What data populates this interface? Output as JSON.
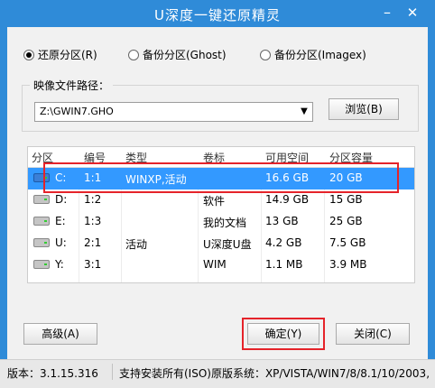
{
  "window": {
    "title": "U深度一键还原精灵",
    "minimize_glyph": "–",
    "close_glyph": "✕"
  },
  "mode": {
    "options": [
      {
        "label": "还原分区(R)",
        "selected": true
      },
      {
        "label": "备份分区(Ghost)",
        "selected": false
      },
      {
        "label": "备份分区(Imagex)",
        "selected": false
      }
    ]
  },
  "image_path": {
    "label": "映像文件路径：",
    "value": "Z:\\GWIN7.GHO",
    "browse_label": "浏览(B)"
  },
  "table": {
    "columns": [
      "分区",
      "编号",
      "类型",
      "卷标",
      "可用空间",
      "分区容量"
    ],
    "rows": [
      {
        "partition": "C:",
        "number": "1:1",
        "type": "WINXP,活动",
        "label": "",
        "free": "16.6 GB",
        "capacity": "20 GB",
        "selected": true,
        "icon": "system-drive-icon"
      },
      {
        "partition": "D:",
        "number": "1:2",
        "type": "",
        "label": "软件",
        "free": "14.9 GB",
        "capacity": "15 GB",
        "selected": false,
        "icon": "drive-icon"
      },
      {
        "partition": "E:",
        "number": "1:3",
        "type": "",
        "label": "我的文档",
        "free": "13 GB",
        "capacity": "25 GB",
        "selected": false,
        "icon": "drive-icon"
      },
      {
        "partition": "U:",
        "number": "2:1",
        "type": "活动",
        "label": "U深度U盘",
        "free": "4.2 GB",
        "capacity": "7.5 GB",
        "selected": false,
        "icon": "usb-drive-icon"
      },
      {
        "partition": "Y:",
        "number": "3:1",
        "type": "",
        "label": "WIM",
        "free": "1.1 MB",
        "capacity": "3.9 MB",
        "selected": false,
        "icon": "drive-icon"
      }
    ]
  },
  "buttons": {
    "advanced": "高级(A)",
    "ok": "确定(Y)",
    "close": "关闭(C)"
  },
  "status": {
    "version": "版本：3.1.15.316",
    "support": "支持安装所有(ISO)原版系统：XP/VISTA/WIN7/8/8.1/10/2003,"
  },
  "colors": {
    "titlebar": "#2f8bd8",
    "selection": "#3399ff",
    "highlight": "#e5232a"
  }
}
